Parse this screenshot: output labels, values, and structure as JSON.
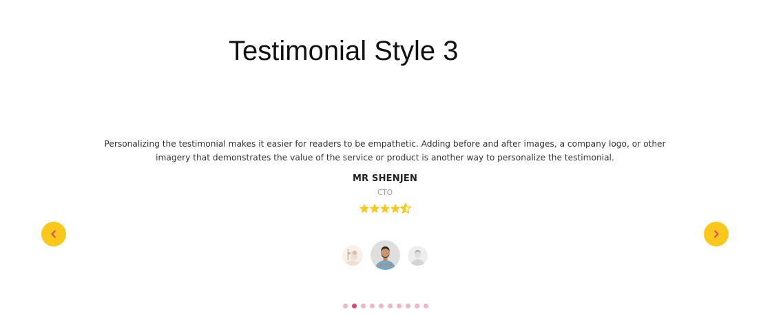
{
  "heading": "Testimonial Style 3",
  "testimonial": {
    "quote": "Personalizing the testimonial makes it easier for readers to be empathetic. Adding before and after images, a company logo, or other imagery that demonstrates the value of the service or product is another way to personalize the testimonial.",
    "name": "MR SHENJEN",
    "role": "CTO",
    "rating": 4.5,
    "rating_max": 5
  },
  "navigation": {
    "prev_icon": "chevron-left-icon",
    "next_icon": "chevron-right-icon",
    "button_color": "#f9c81a",
    "arrow_color": "#d9456e"
  },
  "avatars": [
    {
      "label": "previous-client-avatar"
    },
    {
      "label": "active-client-avatar"
    },
    {
      "label": "next-client-avatar"
    }
  ],
  "pagination": {
    "count": 10,
    "active_index": 1,
    "active_color": "#d9456e",
    "inactive_color": "#f2b3c8"
  },
  "colors": {
    "star": "#f9c81a"
  }
}
